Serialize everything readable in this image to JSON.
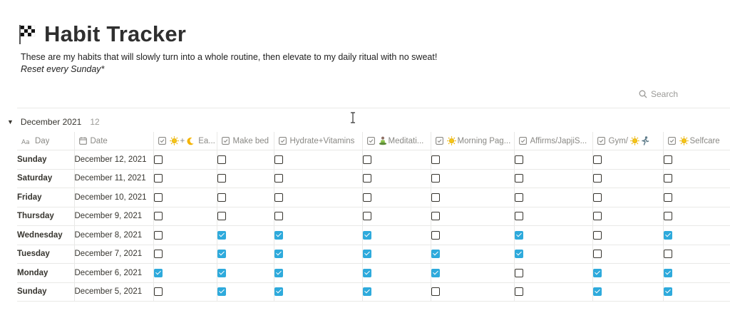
{
  "page": {
    "title": "Habit Tracker",
    "title_icon": "checkered-flag-icon",
    "description": "These are my habits that will slowly turn into a whole routine, then elevate to my daily ritual with no sweat!",
    "note": "Reset every Sunday*"
  },
  "search": {
    "label": "Search"
  },
  "group": {
    "label": "December 2021",
    "count": "12"
  },
  "columns": [
    {
      "label": "Day",
      "icon": "title-aa-icon"
    },
    {
      "label": "Date",
      "icon": "calendar-icon"
    },
    {
      "label": "+",
      "icon": "checkbox-icon",
      "emoji_before": "sun-icon",
      "emoji_after": "moon-icon",
      "suffix": "Ea..."
    },
    {
      "label": "Make bed",
      "icon": "checkbox-icon"
    },
    {
      "label": "Hydrate+Vitamins",
      "icon": "checkbox-icon"
    },
    {
      "label": "Meditati...",
      "icon": "checkbox-icon",
      "emoji_before": "meditation-icon"
    },
    {
      "label": "Morning Pag...",
      "icon": "checkbox-icon",
      "emoji_before": "sun-icon"
    },
    {
      "label": "Affirms/JapjiS...",
      "icon": "checkbox-icon"
    },
    {
      "label": "Gym/",
      "icon": "checkbox-icon",
      "emoji_after_multi": [
        "sun-icon",
        "runner-icon"
      ]
    },
    {
      "label": "Selfcare",
      "icon": "checkbox-icon",
      "emoji_before": "sun-icon"
    }
  ],
  "rows": [
    {
      "day": "Sunday",
      "date": "December 12, 2021",
      "checks": [
        false,
        false,
        false,
        false,
        false,
        false,
        false,
        false
      ]
    },
    {
      "day": "Saturday",
      "date": "December 11, 2021",
      "checks": [
        false,
        false,
        false,
        false,
        false,
        false,
        false,
        false
      ]
    },
    {
      "day": "Friday",
      "date": "December 10, 2021",
      "checks": [
        false,
        false,
        false,
        false,
        false,
        false,
        false,
        false
      ]
    },
    {
      "day": "Thursday",
      "date": "December 9, 2021",
      "checks": [
        false,
        false,
        false,
        false,
        false,
        false,
        false,
        false
      ]
    },
    {
      "day": "Wednesday",
      "date": "December 8, 2021",
      "checks": [
        false,
        true,
        true,
        true,
        false,
        true,
        false,
        true
      ]
    },
    {
      "day": "Tuesday",
      "date": "December 7, 2021",
      "checks": [
        false,
        true,
        true,
        true,
        true,
        true,
        false,
        false
      ]
    },
    {
      "day": "Monday",
      "date": "December 6, 2021",
      "checks": [
        true,
        true,
        true,
        true,
        true,
        false,
        true,
        true
      ]
    },
    {
      "day": "Sunday",
      "date": "December 5, 2021",
      "checks": [
        false,
        true,
        true,
        true,
        false,
        false,
        true,
        true
      ]
    }
  ],
  "colors": {
    "checked": "#2eaadc",
    "text": "#37352f",
    "muted": "#9b9a97",
    "divider": "#e9e9e7"
  }
}
